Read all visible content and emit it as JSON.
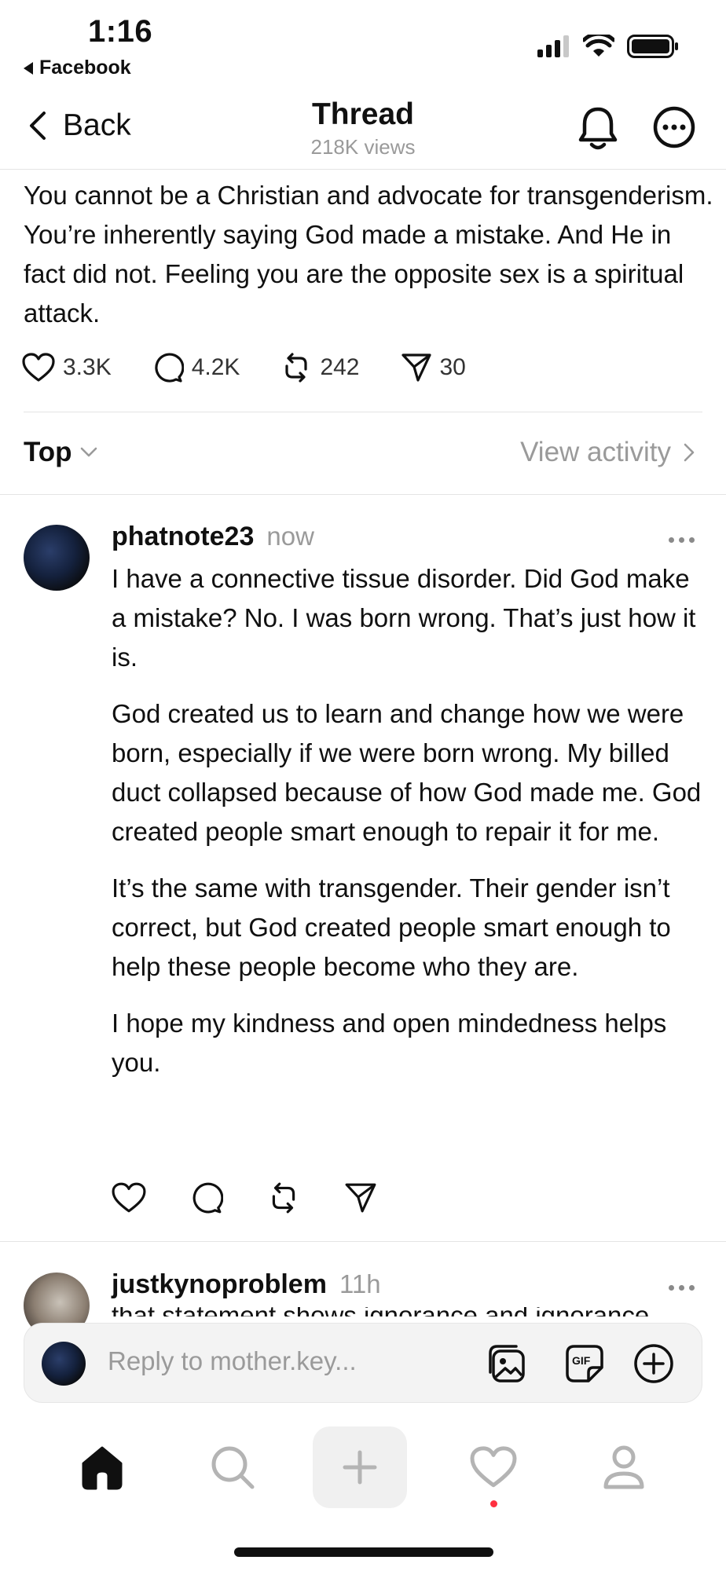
{
  "status_bar": {
    "time": "1:16",
    "back_app": "Facebook"
  },
  "nav": {
    "back_label": "Back",
    "title": "Thread",
    "subtitle": "218K views"
  },
  "post": {
    "text": "You cannot be a Christian and advocate for transgenderism. You’re inherently saying God made a mistake. And He in fact did not. Feeling you are the opposite sex is a spiritual attack.",
    "likes": "3.3K",
    "replies": "4.2K",
    "reposts": "242",
    "shares": "30"
  },
  "sort": {
    "label": "Top",
    "view_activity": "View activity"
  },
  "replies": [
    {
      "username": "phatnote23",
      "time": "now",
      "paragraphs": [
        "I have a connective tissue disorder. Did God make a mistake? No. I was born wrong. That’s just how it is.",
        "God created us to learn and change how we were born, especially if we were born wrong. My billed duct collapsed because of how God made me. God created people smart enough to repair it for me.",
        "It’s the same with transgender. Their gender isn’t correct, but God created people smart enough to help these people become who they are.",
        "I hope my kindness and open mindedness helps you."
      ]
    },
    {
      "username": "justkynoproblem",
      "time": "11h",
      "peek": "that statement shows ignorance and ignorance"
    }
  ],
  "composer": {
    "placeholder": "Reply to mother.key..."
  },
  "colors": {
    "text": "#101010",
    "muted": "#9a9a9a",
    "divider": "#e4e4e4",
    "notification_dot": "#ff3040"
  }
}
